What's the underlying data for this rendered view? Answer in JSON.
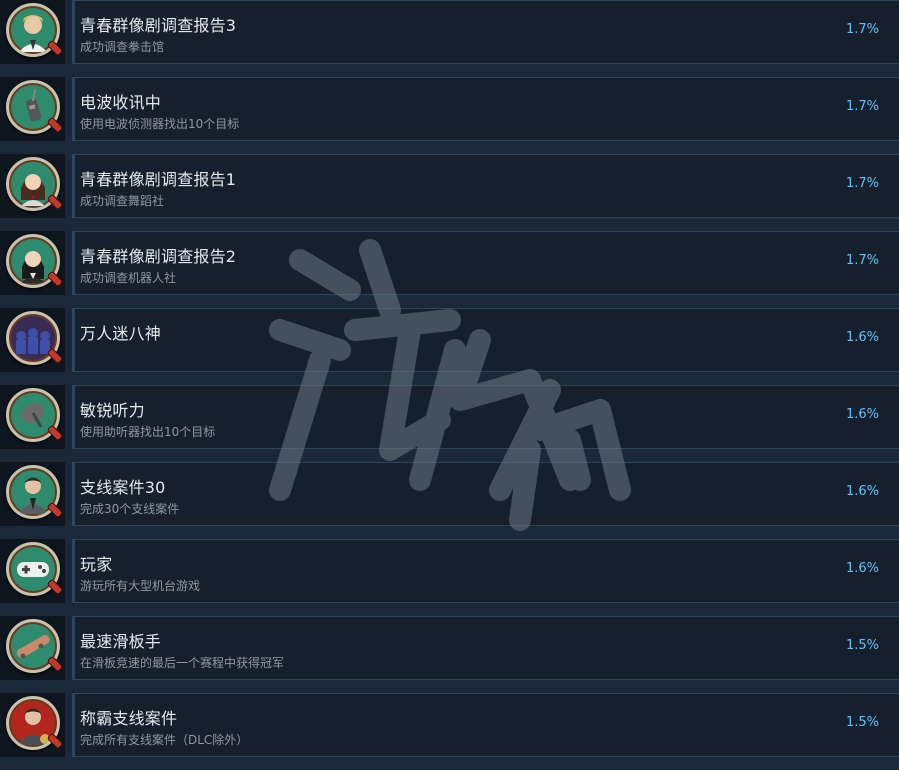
{
  "achievements": [
    {
      "title": "青春群像剧调查报告3",
      "desc": "成功调查拳击馆",
      "pct": "1.7%",
      "icon": "portrait-blond-man-icon",
      "ring": "#2e8b6e"
    },
    {
      "title": "电波收讯中",
      "desc": "使用电波侦测器找出10个目标",
      "pct": "1.7%",
      "icon": "radio-detector-icon",
      "ring": "#2e8b6e"
    },
    {
      "title": "青春群像剧调查报告1",
      "desc": "成功调查舞蹈社",
      "pct": "1.7%",
      "icon": "portrait-schoolgirl-icon",
      "ring": "#2e8b6e"
    },
    {
      "title": "青春群像剧调查报告2",
      "desc": "成功调查机器人社",
      "pct": "1.7%",
      "icon": "portrait-dark-hair-girl-icon",
      "ring": "#2e8b6e"
    },
    {
      "title": "万人迷八神",
      "desc": "",
      "pct": "1.6%",
      "icon": "crowd-icon",
      "ring": "#3a2b55"
    },
    {
      "title": "敏锐听力",
      "desc": "使用助听器找出10个目标",
      "pct": "1.6%",
      "icon": "listening-dish-icon",
      "ring": "#2e8b6e"
    },
    {
      "title": "支线案件30",
      "desc": "完成30个支线案件",
      "pct": "1.6%",
      "icon": "detective-portrait-icon",
      "ring": "#2e8b6e"
    },
    {
      "title": "玩家",
      "desc": "游玩所有大型机台游戏",
      "pct": "1.6%",
      "icon": "gamepad-icon",
      "ring": "#2e8b6e"
    },
    {
      "title": "最速滑板手",
      "desc": "在滑板竞速的最后一个赛程中获得冠军",
      "pct": "1.5%",
      "icon": "skateboard-icon",
      "ring": "#2e8b6e"
    },
    {
      "title": "称霸支线案件",
      "desc": "完成所有支线案件（DLC除外）",
      "pct": "1.5%",
      "icon": "detective-portrait-gold-icon",
      "ring": "#b3261e"
    }
  ],
  "colors": {
    "background": "#1b2838",
    "title": "#e6e9ec",
    "description": "#8f98a0",
    "percent": "#66c0f4",
    "border": "#2a475e"
  }
}
